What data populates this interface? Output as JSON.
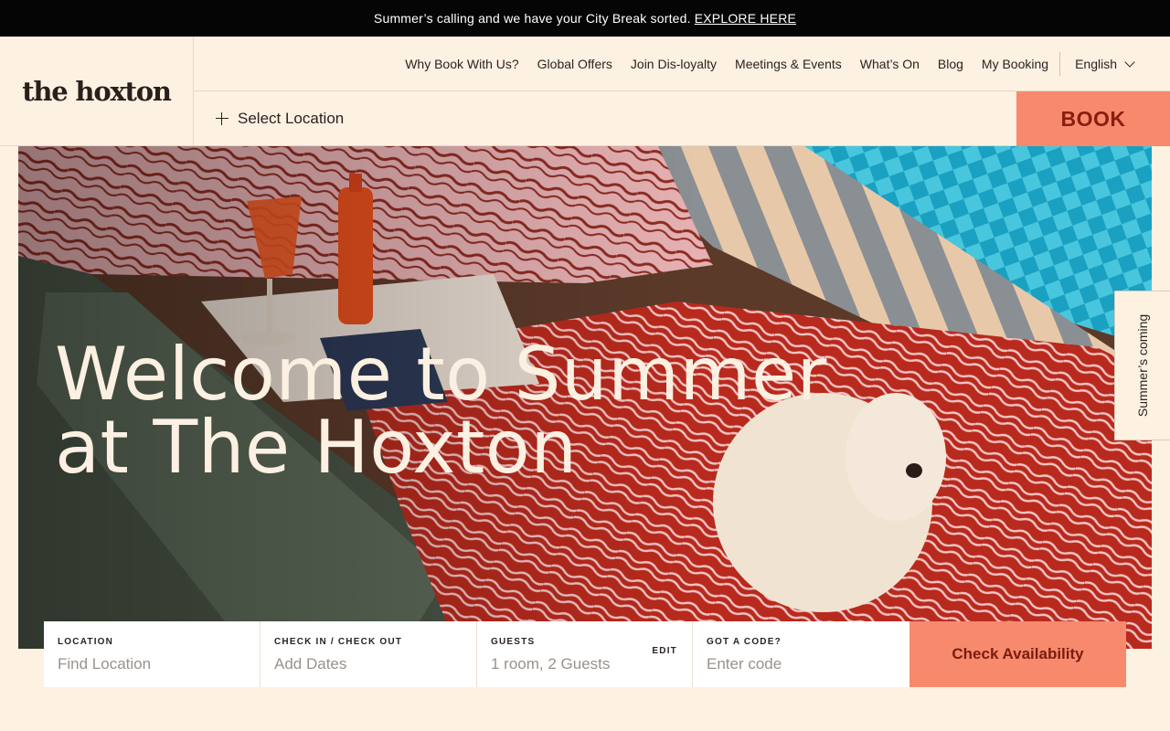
{
  "announcement": {
    "text": "Summer’s calling and we have your City Break sorted.",
    "link": "EXPLORE HERE"
  },
  "logo": "the hoxton",
  "nav": {
    "items": [
      "Why Book With Us?",
      "Global Offers",
      "Join Dis-loyalty",
      "Meetings & Events",
      "What’s On",
      "Blog",
      "My Booking"
    ],
    "language": "English"
  },
  "location_selector": {
    "label": "Select Location"
  },
  "book_button": "BOOK",
  "hero": {
    "title_line1": "Welcome to Summer",
    "title_line2": "at The Hoxton"
  },
  "side_tab": "Summer’s coming",
  "search": {
    "location": {
      "label": "LOCATION",
      "placeholder": "Find Location"
    },
    "dates": {
      "label": "CHECK IN / CHECK OUT",
      "placeholder": "Add Dates"
    },
    "guests": {
      "label": "GUESTS",
      "value": "1 room, 2 Guests",
      "edit": "EDIT"
    },
    "code": {
      "label": "GOT A CODE?",
      "placeholder": "Enter code"
    },
    "submit": "Check Availability"
  },
  "colors": {
    "accent": "#f78a6d",
    "background": "#fdf1e2",
    "bar": "#050505"
  }
}
